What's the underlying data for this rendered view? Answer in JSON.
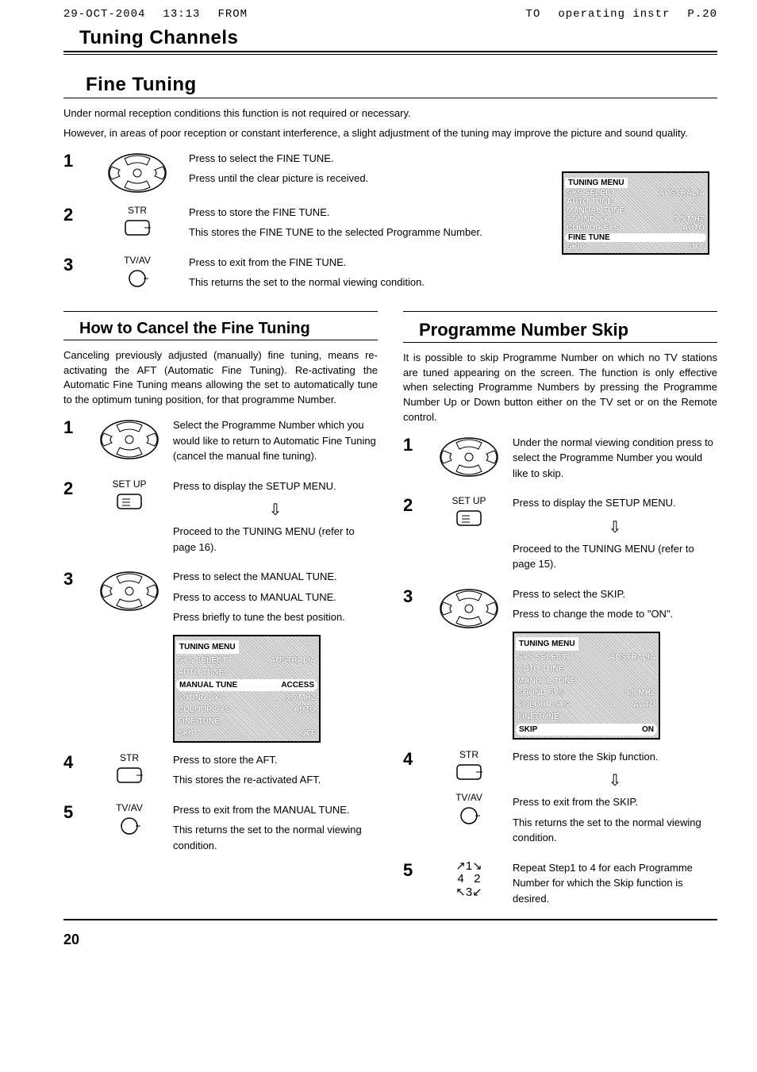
{
  "fax": {
    "date": "29-OCT-2004",
    "time": "13:13",
    "from": "FROM",
    "to": "TO",
    "doc": "operating instr",
    "page": "P.20"
  },
  "footer_page": "20",
  "sec_tuning": "Tuning Channels",
  "sec_fine": "Fine Tuning",
  "fine_intro1": "Under normal reception conditions this function is not required or necessary.",
  "fine_intro2": "However, in areas of poor reception or constant interference, a slight adjustment of the tuning may improve the picture and sound quality.",
  "fine": {
    "s1a": "Press to select the FINE TUNE.",
    "s1b": "Press until the clear picture is received.",
    "s2_label": "STR",
    "s2a": "Press to store the FINE TUNE.",
    "s2b": "This stores the FINE TUNE to the selected Programme Number.",
    "s3_label": "TV/AV",
    "s3a": "Press to exit from the FINE TUNE.",
    "s3b": "This returns the set to the normal viewing condition."
  },
  "menu_main": {
    "title": "TUNING MENU",
    "r1": {
      "l": "SYS SELECT",
      "v": "AUSTRALIA"
    },
    "r2": {
      "l": "AUTO TUNE",
      "v": ""
    },
    "r3": {
      "l": "MANUAL TUNE",
      "v": ""
    },
    "r4": {
      "l": "SOUND SYS",
      "v": "5.5 MHZ"
    },
    "r5": {
      "l": "COLOUR SYS",
      "v": "AUTO"
    },
    "r6": {
      "l": "FINE TUNE",
      "v": ""
    },
    "r7": {
      "l": "SKIP",
      "v": "OFF"
    }
  },
  "cancel": {
    "head": "How to Cancel the Fine Tuning",
    "intro": "Canceling previously adjusted (manually) fine tuning, means re-activating the AFT (Automatic Fine Tuning). Re-activating the Automatic Fine Tuning means allowing the set to automatically tune to the optimum tuning position, for that programme Number.",
    "s1": "Select the Programme Number which you would like to return to Automatic Fine Tuning (cancel the manual fine tuning).",
    "s2_label": "SET UP",
    "s2a": "Press to display the SETUP MENU.",
    "s2b": "Proceed to the TUNING MENU (refer to page 16).",
    "s3a": "Press to select the MANUAL TUNE.",
    "s3b": "Press to access to MANUAL TUNE.",
    "s3c": "Press briefly to tune the best position.",
    "s4_label": "STR",
    "s4a": "Press to store the AFT.",
    "s4b": "This stores the re-activated AFT.",
    "s5_label": "TV/AV",
    "s5a": "Press to exit from the MANUAL TUNE.",
    "s5b": "This returns the set to the normal viewing condition."
  },
  "menu_cancel": {
    "title": "TUNING MENU",
    "r1": {
      "l": "SYS SELECT",
      "v": "AUSTRALIA"
    },
    "r2": {
      "l": "AUTO TUNE",
      "v": ""
    },
    "r3": {
      "l": "MANUAL TUNE",
      "v": "ACCESS"
    },
    "r4": {
      "l": "SOUND SYS",
      "v": "5.5 MHZ"
    },
    "r5": {
      "l": "COLOUR SYS",
      "v": "AUTO"
    },
    "r6": {
      "l": "FINE TUNE",
      "v": ""
    },
    "r7": {
      "l": "SKIP",
      "v": "OFF"
    }
  },
  "skip": {
    "head": "Programme Number Skip",
    "intro": "It is possible to skip Programme Number on which no TV stations are tuned appearing on the screen. The function is only effective when selecting Programme Numbers by pressing the Programme Number Up or Down button either on the TV set or on the Remote control.",
    "s1": "Under the normal viewing condition press to select the Programme Number you would like to skip.",
    "s2_label": "SET UP",
    "s2a": "Press to display the SETUP MENU.",
    "s2b": "Proceed to the TUNING MENU (refer to page 15).",
    "s3a": "Press to select the SKIP.",
    "s3b": "Press to change the mode to \"ON\".",
    "s4_label1": "STR",
    "s4a": "Press to store the Skip function.",
    "s4_label2": "TV/AV",
    "s4b": "Press to exit from  the SKIP.",
    "s4c": "This returns the set to the normal viewing condition.",
    "s5": "Repeat Step1 to 4 for each Programme Number for which the Skip function is desired."
  },
  "menu_skip": {
    "title": "TUNING MENU",
    "r1": {
      "l": "SYS SELECT",
      "v": "AUSTRALIA"
    },
    "r2": {
      "l": "AUTO TUNE",
      "v": ""
    },
    "r3": {
      "l": "MANUAL TUNE",
      "v": ""
    },
    "r4": {
      "l": "SOUND SYS",
      "v": "5.5 MHZ"
    },
    "r5": {
      "l": "COLOUR SYS",
      "v": "AUTO"
    },
    "r6": {
      "l": "FINE TUNE",
      "v": ""
    },
    "r7": {
      "l": "SKIP",
      "v": "ON"
    }
  }
}
